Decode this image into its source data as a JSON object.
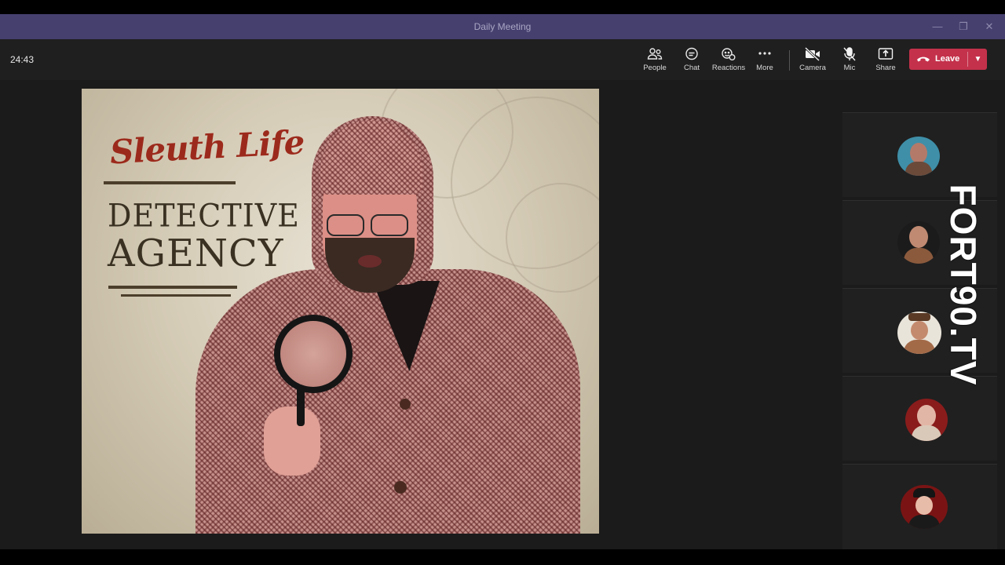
{
  "window": {
    "title": "Daily Meeting",
    "controls": {
      "minimize": "—",
      "restore": "❐",
      "close": "✕"
    }
  },
  "meeting": {
    "timer": "24:43"
  },
  "toolbar": {
    "people": {
      "label": "People",
      "icon": "people-icon"
    },
    "chat": {
      "label": "Chat",
      "icon": "chat-icon"
    },
    "reactions": {
      "label": "Reactions",
      "icon": "reactions-icon"
    },
    "more": {
      "label": "More",
      "icon": "more-icon"
    },
    "camera": {
      "label": "Camera",
      "icon": "camera-off-icon"
    },
    "mic": {
      "label": "Mic",
      "icon": "mic-off-icon"
    },
    "share": {
      "label": "Share",
      "icon": "share-icon"
    },
    "leave": {
      "label": "Leave",
      "icon": "phone-hangup-icon",
      "color": "#c4314b"
    }
  },
  "main_video": {
    "logo_line1": "Sleuth Life",
    "logo_line2": "DETECTIVE",
    "logo_line3": "AGENCY"
  },
  "participants": [
    {
      "avatar_bg": "#3f8fa8"
    },
    {
      "avatar_bg": "#1b1b1b"
    },
    {
      "avatar_bg": "#e9e4da"
    },
    {
      "avatar_bg": "#8a1c1c"
    },
    {
      "avatar_bg": "#7a1414"
    }
  ],
  "watermark": "FORT90.TV",
  "colors": {
    "titlebar": "#45406e",
    "toolbar": "#1f1f1f",
    "stage": "#1b1b1b",
    "leave": "#c4314b"
  }
}
